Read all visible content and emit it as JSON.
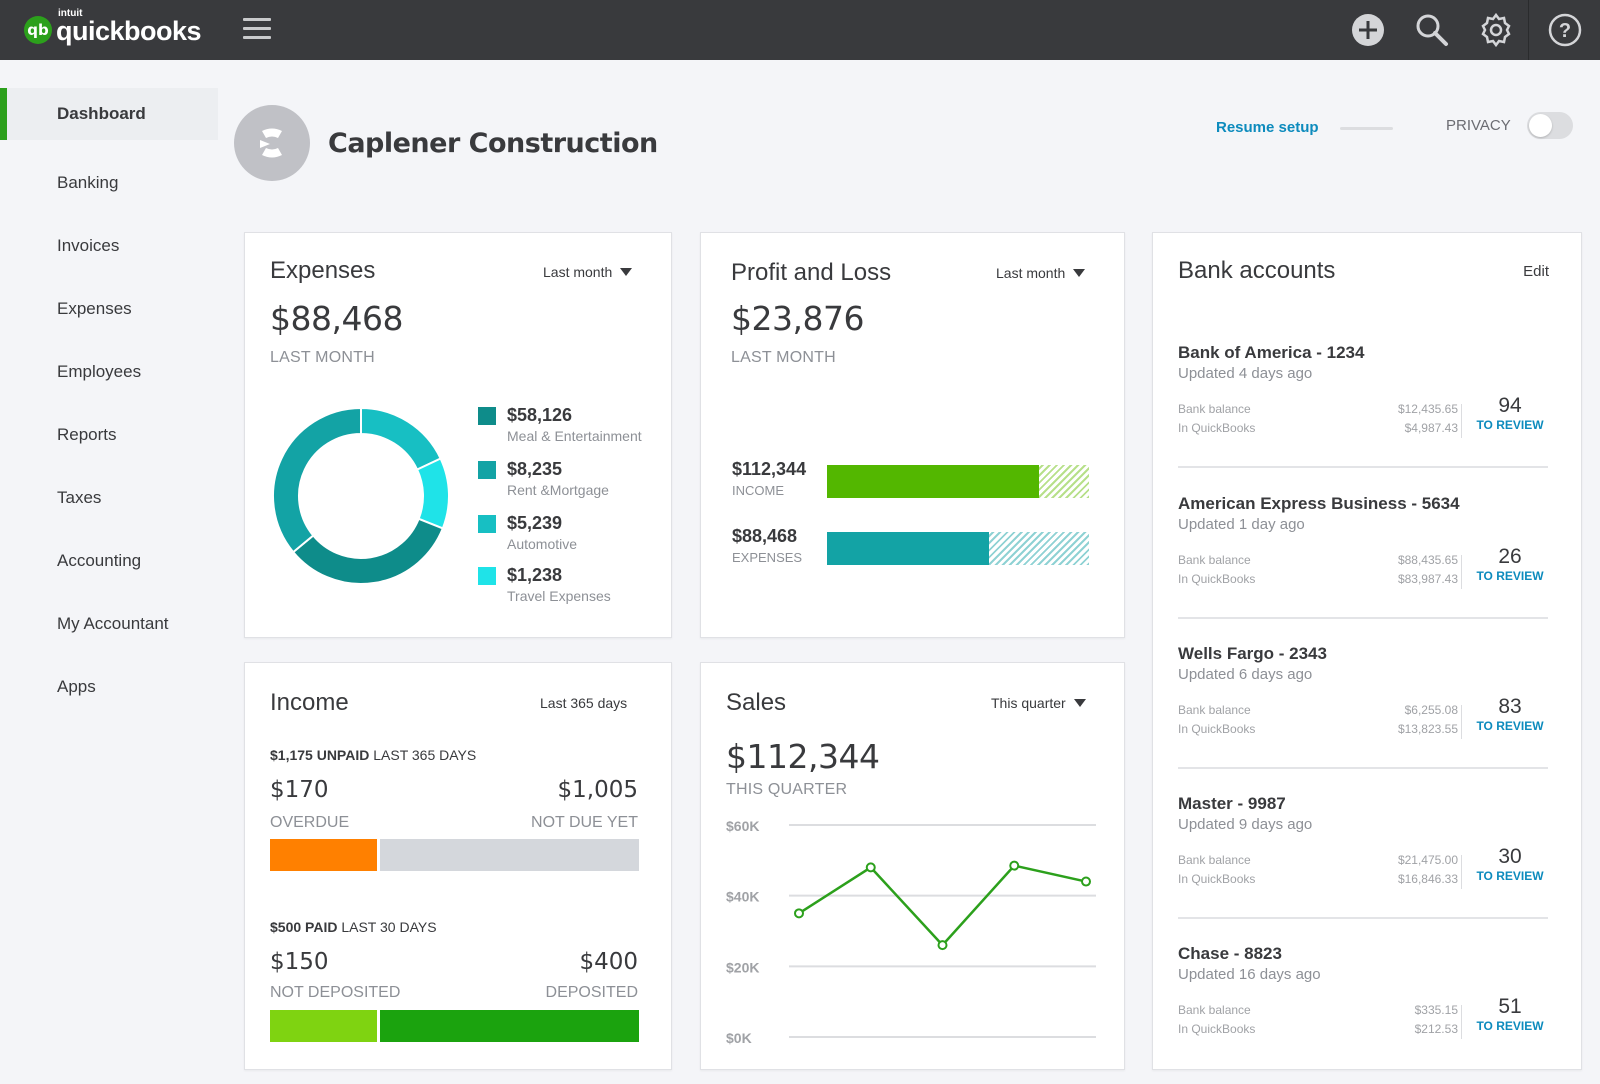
{
  "app": {
    "brand_small": "intuit",
    "brand": "quickbooks",
    "brand_badge": "qb"
  },
  "topbar": {
    "icons": [
      "plus-icon",
      "search-icon",
      "gear-icon",
      "help-icon"
    ]
  },
  "sidebar": {
    "items": [
      {
        "label": "Dashboard",
        "active": true
      },
      {
        "label": "Banking"
      },
      {
        "label": "Invoices"
      },
      {
        "label": "Expenses"
      },
      {
        "label": "Employees"
      },
      {
        "label": "Reports"
      },
      {
        "label": "Taxes"
      },
      {
        "label": "Accounting"
      },
      {
        "label": "My Accountant"
      },
      {
        "label": "Apps"
      }
    ]
  },
  "header": {
    "company_name": "Caplener Construction",
    "resume_setup": "Resume setup",
    "privacy_label": "PRIVACY",
    "privacy_on": false
  },
  "expenses": {
    "title": "Expenses",
    "period": "Last month",
    "total": "$88,468",
    "caption": "LAST MONTH",
    "legend": [
      {
        "value": "$58,126",
        "label": "Meal & Entertainment",
        "color": "#0e8c8a"
      },
      {
        "value": "$8,235",
        "label": "Rent &Mortgage",
        "color": "#13a3a5"
      },
      {
        "value": "$5,239",
        "label": "Automotive",
        "color": "#17bfc3"
      },
      {
        "value": "$1,238",
        "label": "Travel Expenses",
        "color": "#1fe3e8"
      }
    ]
  },
  "profit_loss": {
    "title": "Profit and Loss",
    "period": "Last month",
    "total": "$23,876",
    "caption": "LAST MONTH",
    "rows": [
      {
        "value": "$112,344",
        "label": "INCOME",
        "fill": 0.81,
        "color": "#53b700"
      },
      {
        "value": "$88,468",
        "label": "EXPENSES",
        "fill": 0.62,
        "color": "#13a3a5"
      }
    ]
  },
  "income": {
    "title": "Income",
    "period": "Last 365 days",
    "unpaid": {
      "amount": "$1,175 UNPAID",
      "range": "LAST 365 DAYS",
      "left_amt": "$170",
      "left_lbl": "OVERDUE",
      "right_amt": "$1,005",
      "right_lbl": "NOT DUE YET",
      "left_fraction": 0.29,
      "left_color": "#ff8000",
      "right_color": "#d4d7dc"
    },
    "paid": {
      "amount": "$500 PAID",
      "range": "LAST 30 DAYS",
      "left_amt": "$150",
      "left_lbl": "NOT DEPOSITED",
      "right_amt": "$400",
      "right_lbl": "DEPOSITED",
      "left_fraction": 0.29,
      "left_color": "#7fd311",
      "right_color": "#1ba30e"
    }
  },
  "sales": {
    "title": "Sales",
    "period": "This quarter",
    "total": "$112,344",
    "caption": "THIS QUARTER"
  },
  "chart_data": [
    {
      "type": "pie",
      "title": "Expenses",
      "categories": [
        "Meal & Entertainment",
        "Rent &Mortgage",
        "Automotive",
        "Travel Expenses"
      ],
      "values": [
        58126,
        8235,
        5239,
        1238
      ],
      "donut": true
    },
    {
      "type": "line",
      "title": "Sales",
      "x": [
        1,
        2,
        3,
        4,
        5
      ],
      "series": [
        {
          "name": "Sales",
          "values": [
            35000,
            48000,
            26000,
            48500,
            44000
          ],
          "color": "#2ca01c"
        }
      ],
      "yticks": [
        "$0K",
        "$20K",
        "$40K",
        "$60K"
      ],
      "ylim": [
        0,
        60000
      ],
      "grid": true
    }
  ],
  "bank": {
    "title": "Bank accounts",
    "edit": "Edit",
    "balance_label": "Bank balance",
    "qb_label": "In QuickBooks",
    "review_label": "TO REVIEW",
    "accounts": [
      {
        "name": "Bank of America - 1234",
        "updated": "Updated 4 days ago",
        "bank_balance": "$12,435.65",
        "qb_balance": "$4,987.43",
        "review": "94"
      },
      {
        "name": "American Express Business - 5634",
        "updated": "Updated 1 day ago",
        "bank_balance": "$88,435.65",
        "qb_balance": "$83,987.43",
        "review": "26"
      },
      {
        "name": "Wells Fargo - 2343",
        "updated": "Updated 6 days ago",
        "bank_balance": "$6,255.08",
        "qb_balance": "$13,823.55",
        "review": "83"
      },
      {
        "name": "Master - 9987",
        "updated": "Updated 9 days ago",
        "bank_balance": "$21,475.00",
        "qb_balance": "$16,846.33",
        "review": "30"
      },
      {
        "name": "Chase - 8823",
        "updated": "Updated 16 days ago",
        "bank_balance": "$335.15",
        "qb_balance": "$212.53",
        "review": "51"
      }
    ]
  }
}
